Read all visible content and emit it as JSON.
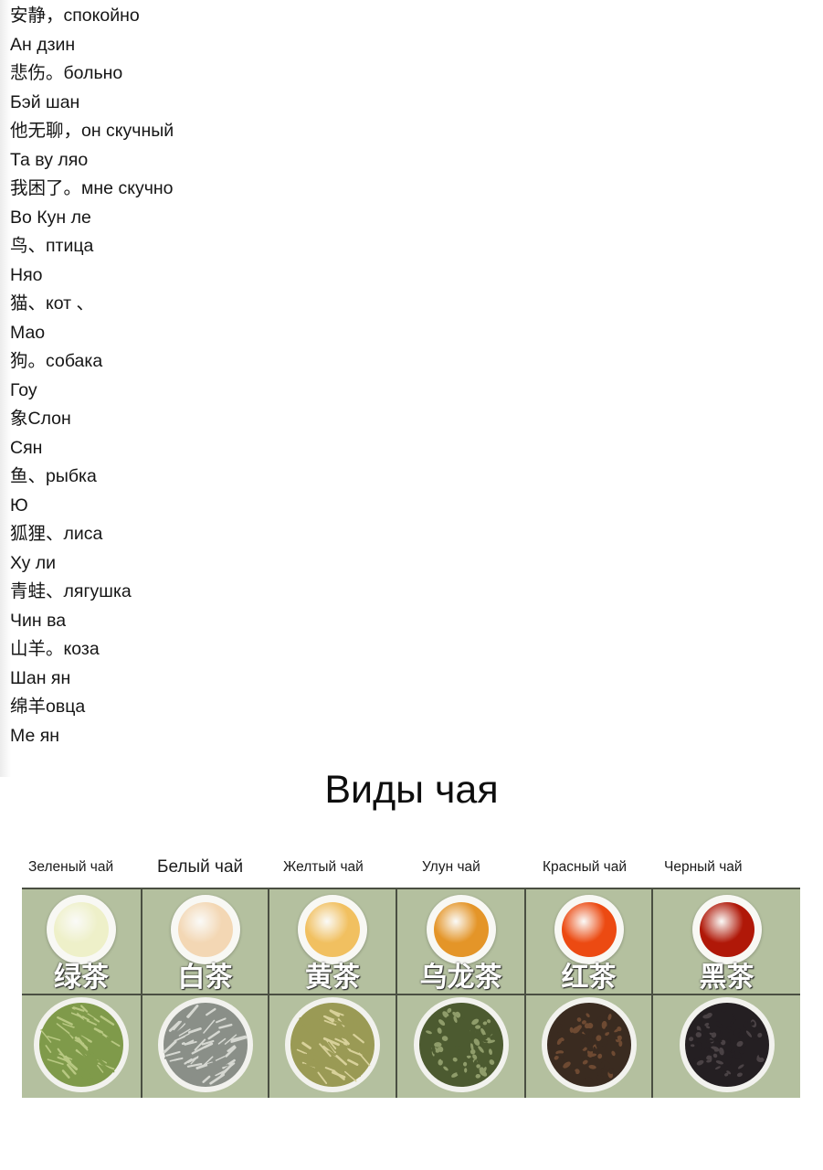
{
  "vocabulary": [
    "安静，спокойно",
    "Ан дзин",
    "悲伤。больно",
    "Бэй шан",
    "他无聊，он скучный",
    "Та ву ляо",
    "我困了。мне скучно",
    "Во Кун ле",
    "鸟、птица",
    "Няо",
    "猫、кот 、",
    "Мао",
    "狗。собака",
    "Гоу",
    "象Слон",
    "Сян",
    "鱼、рыбка",
    "Ю",
    "狐狸、лиса",
    "Ху ли",
    "青蛙、лягушка",
    "Чин ва",
    "山羊。коза",
    "Шан ян",
    "绵羊овца",
    "Ме ян"
  ],
  "tea_section": {
    "title": "Виды чая",
    "teas": [
      {
        "ru": "Зеленый чай",
        "cn": "绿茶",
        "liquid_color": "#eef0c9",
        "leaf_color": "#7f9a4a",
        "leaf_color2": "#b8c882"
      },
      {
        "ru": "Белый чай",
        "cn": "白茶",
        "liquid_color": "#f3d7b4",
        "leaf_color": "#8a8f88",
        "leaf_color2": "#d6d8d2"
      },
      {
        "ru": "Желтый чай",
        "cn": "黄茶",
        "liquid_color": "#f1c060",
        "leaf_color": "#9a9a55",
        "leaf_color2": "#d8d19a"
      },
      {
        "ru": "Улун чай",
        "cn": "乌龙茶",
        "liquid_color": "#e49528",
        "leaf_color": "#4c5a30",
        "leaf_color2": "#8f9c6a"
      },
      {
        "ru": "Красный чай",
        "cn": "红茶",
        "liquid_color": "#ec4a12",
        "leaf_color": "#3a2b20",
        "leaf_color2": "#6e4a32"
      },
      {
        "ru": "Черный чай",
        "cn": "黑茶",
        "liquid_color": "#b01808",
        "leaf_color": "#241f22",
        "leaf_color2": "#4a4245"
      }
    ]
  }
}
